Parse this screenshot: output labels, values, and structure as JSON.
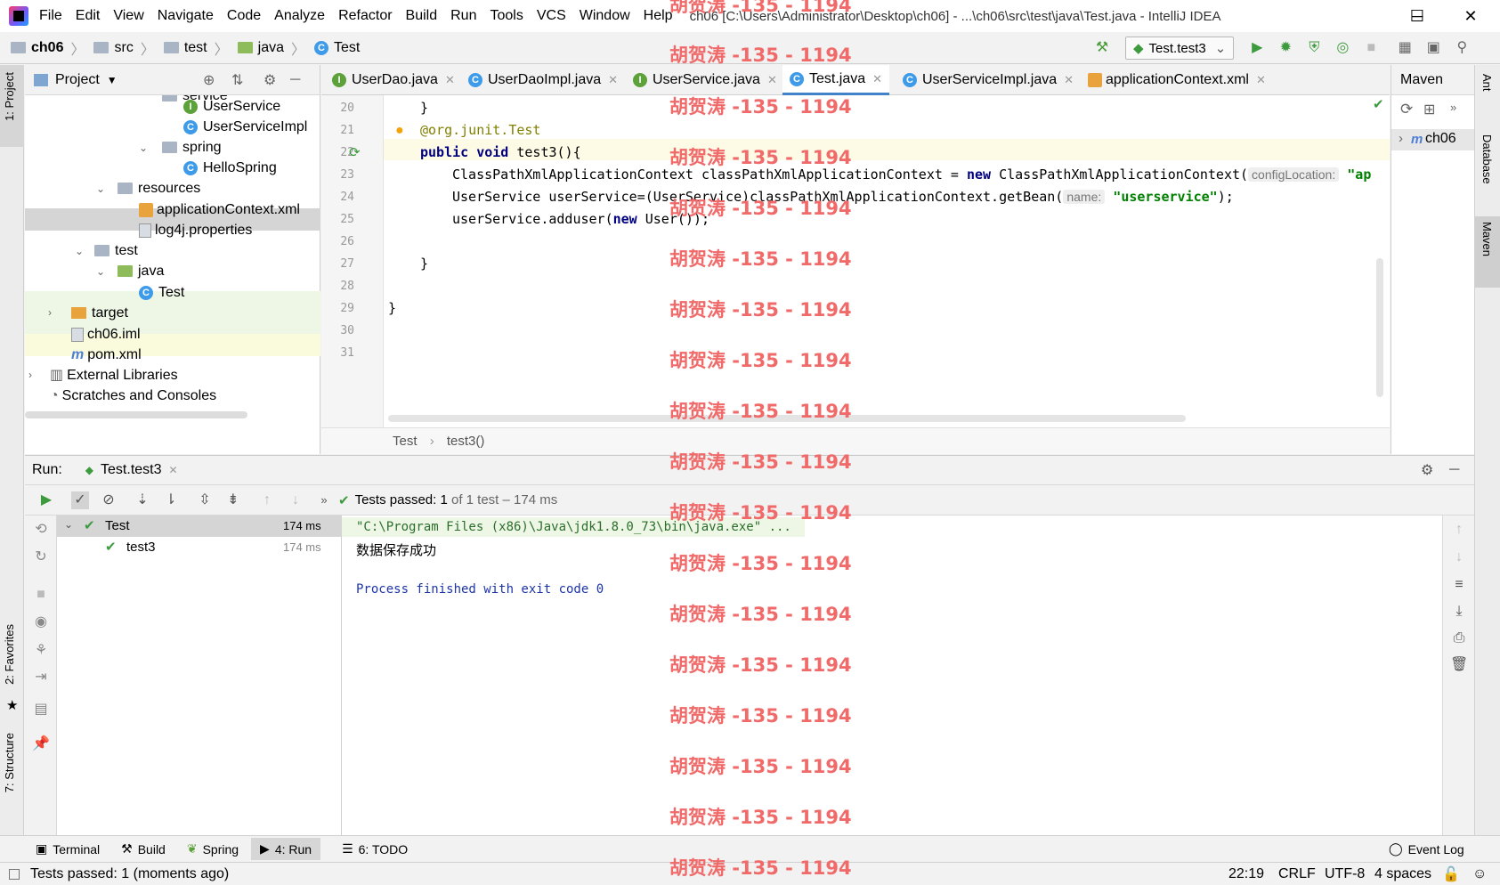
{
  "window": {
    "title": "ch06 [C:\\Users\\Administrator\\Desktop\\ch06] - ...\\ch06\\src\\test\\java\\Test.java - IntelliJ IDEA",
    "controls": [
      "─",
      "☐",
      "✕"
    ]
  },
  "menu": [
    "File",
    "Edit",
    "View",
    "Navigate",
    "Code",
    "Analyze",
    "Refactor",
    "Build",
    "Run",
    "Tools",
    "VCS",
    "Window",
    "Help"
  ],
  "breadcrumb": [
    "ch06",
    "src",
    "test",
    "java",
    "Test"
  ],
  "run_config": "Test.test3",
  "left_tabs": {
    "project": "1: Project",
    "favorites": "2: Favorites",
    "structure": "7: Structure"
  },
  "right_tabs": {
    "ant": "Ant",
    "database": "Database",
    "maven": "Maven"
  },
  "project": {
    "title": "Project",
    "tree": [
      {
        "label": "service",
        "type": "folder"
      },
      {
        "label": "UserService",
        "type": "interface"
      },
      {
        "label": "UserServiceImpl",
        "type": "class"
      },
      {
        "label": "spring",
        "type": "folder"
      },
      {
        "label": "HelloSpring",
        "type": "class"
      },
      {
        "label": "resources",
        "type": "folder"
      },
      {
        "label": "applicationContext.xml",
        "type": "xml"
      },
      {
        "label": "log4j.properties",
        "type": "properties"
      },
      {
        "label": "test",
        "type": "folder"
      },
      {
        "label": "java",
        "type": "folder"
      },
      {
        "label": "Test",
        "type": "class"
      },
      {
        "label": "target",
        "type": "folder"
      },
      {
        "label": "ch06.iml",
        "type": "file"
      },
      {
        "label": "pom.xml",
        "type": "maven"
      },
      {
        "label": "External Libraries",
        "type": "lib"
      },
      {
        "label": "Scratches and Consoles",
        "type": "scratch"
      }
    ]
  },
  "editor_tabs": [
    {
      "label": "UserDao.java",
      "icon": "I"
    },
    {
      "label": "UserDaoImpl.java",
      "icon": "C"
    },
    {
      "label": "UserService.java",
      "icon": "I"
    },
    {
      "label": "Test.java",
      "icon": "C"
    },
    {
      "label": "UserServiceImpl.java",
      "icon": "C"
    },
    {
      "label": "applicationContext.xml",
      "icon": "X"
    }
  ],
  "code": {
    "line_numbers": [
      "20",
      "21",
      "22",
      "23",
      "24",
      "25",
      "26",
      "27",
      "28",
      "29",
      "30",
      "31"
    ],
    "l20": "}",
    "l21_at": "@org.junit.",
    "l21_test": "Test",
    "l22_kw": "public void ",
    "l22_rest": "test3(){",
    "l23_a": "ClassPathXmlApplicationContext classPathXmlApplicationContext = ",
    "l23_kw": "new",
    "l23_b": " ClassPathXmlApplicationContext(",
    "l23_hint": "configLocation:",
    "l23_str": "\"ap",
    "l24_a": "UserService userService=(UserService)classPathXmlApplicationContext.getBean(",
    "l24_hint": "name:",
    "l24_str": "\"userservice\"",
    "l24_end": ");",
    "l25_a": "userService.adduser(",
    "l25_kw": "new",
    "l25_b": " User());",
    "l27": "}",
    "l29": "}"
  },
  "editor_breadcrumb": [
    "Test",
    "test3()"
  ],
  "maven": {
    "title": "Maven",
    "project": "ch06"
  },
  "run": {
    "label": "Run:",
    "tab": "Test.test3",
    "status_prefix": "Tests passed: ",
    "status_count": "1",
    "status_suffix": " of 1 test – 174 ms",
    "tree": [
      {
        "label": "Test",
        "time": "174 ms"
      },
      {
        "label": "test3",
        "time": "174 ms"
      }
    ],
    "console": [
      "\"C:\\Program Files (x86)\\Java\\jdk1.8.0_73\\bin\\java.exe\" ...",
      "数据保存成功",
      "",
      "Process finished with exit code 0"
    ]
  },
  "bottom_tabs": [
    "Terminal",
    "Build",
    "Spring",
    "4: Run",
    "6: TODO"
  ],
  "event_log": "Event Log",
  "status": {
    "message": "Tests passed: 1 (moments ago)",
    "position": "22:19",
    "line_sep": "CRLF",
    "encoding": "UTF-8",
    "indent": "4 spaces"
  },
  "watermark": "胡贺涛 -135 - 1194",
  "colors": {
    "accent": "#4083c9",
    "keyword": "#000080",
    "string": "#008000",
    "annotation": "#808000",
    "watermark": "#f06a6a",
    "pass": "#3d9a3d"
  }
}
